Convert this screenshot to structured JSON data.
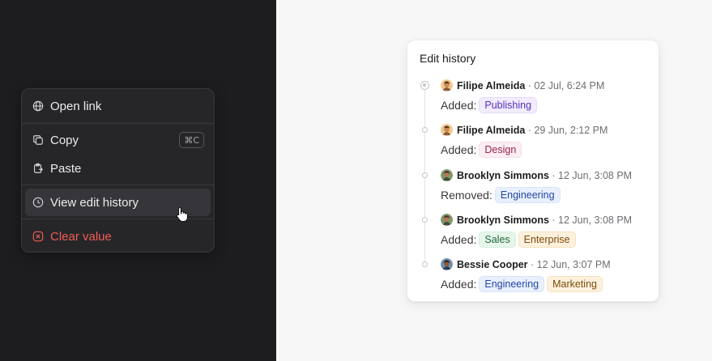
{
  "context_menu": {
    "items": [
      {
        "label": "Open link",
        "icon": "globe-icon"
      },
      {
        "label": "Copy",
        "icon": "copy-icon",
        "shortcut": "⌘C"
      },
      {
        "label": "Paste",
        "icon": "clipboard-paste-icon"
      },
      {
        "label": "View edit history",
        "icon": "clock-icon",
        "hovered": true
      },
      {
        "label": "Clear value",
        "icon": "x-circle-icon",
        "danger": true
      }
    ]
  },
  "edit_history": {
    "title": "Edit history",
    "entries": [
      {
        "name": "Filipe Almeida",
        "time": "· 02 Jul, 6:24 PM",
        "verb": "Added:",
        "tags": [
          "Publishing"
        ]
      },
      {
        "name": "Filipe Almeida",
        "time": "· 29 Jun, 2:12 PM",
        "verb": "Added:",
        "tags": [
          "Design"
        ]
      },
      {
        "name": "Brooklyn Simmons",
        "time": "· 12 Jun, 3:08 PM",
        "verb": "Removed:",
        "tags": [
          "Engineering"
        ]
      },
      {
        "name": "Brooklyn Simmons",
        "time": "· 12 Jun, 3:08 PM",
        "verb": "Added:",
        "tags": [
          "Sales",
          "Enterprise"
        ]
      },
      {
        "name": "Bessie Cooper",
        "time": "· 12 Jun, 3:07 PM",
        "verb": "Added:",
        "tags": [
          "Engineering",
          "Marketing"
        ]
      }
    ]
  },
  "colors": {
    "dark_bg": "#1d1d20",
    "light_bg": "#f7f7f8",
    "danger": "#f25c54"
  }
}
